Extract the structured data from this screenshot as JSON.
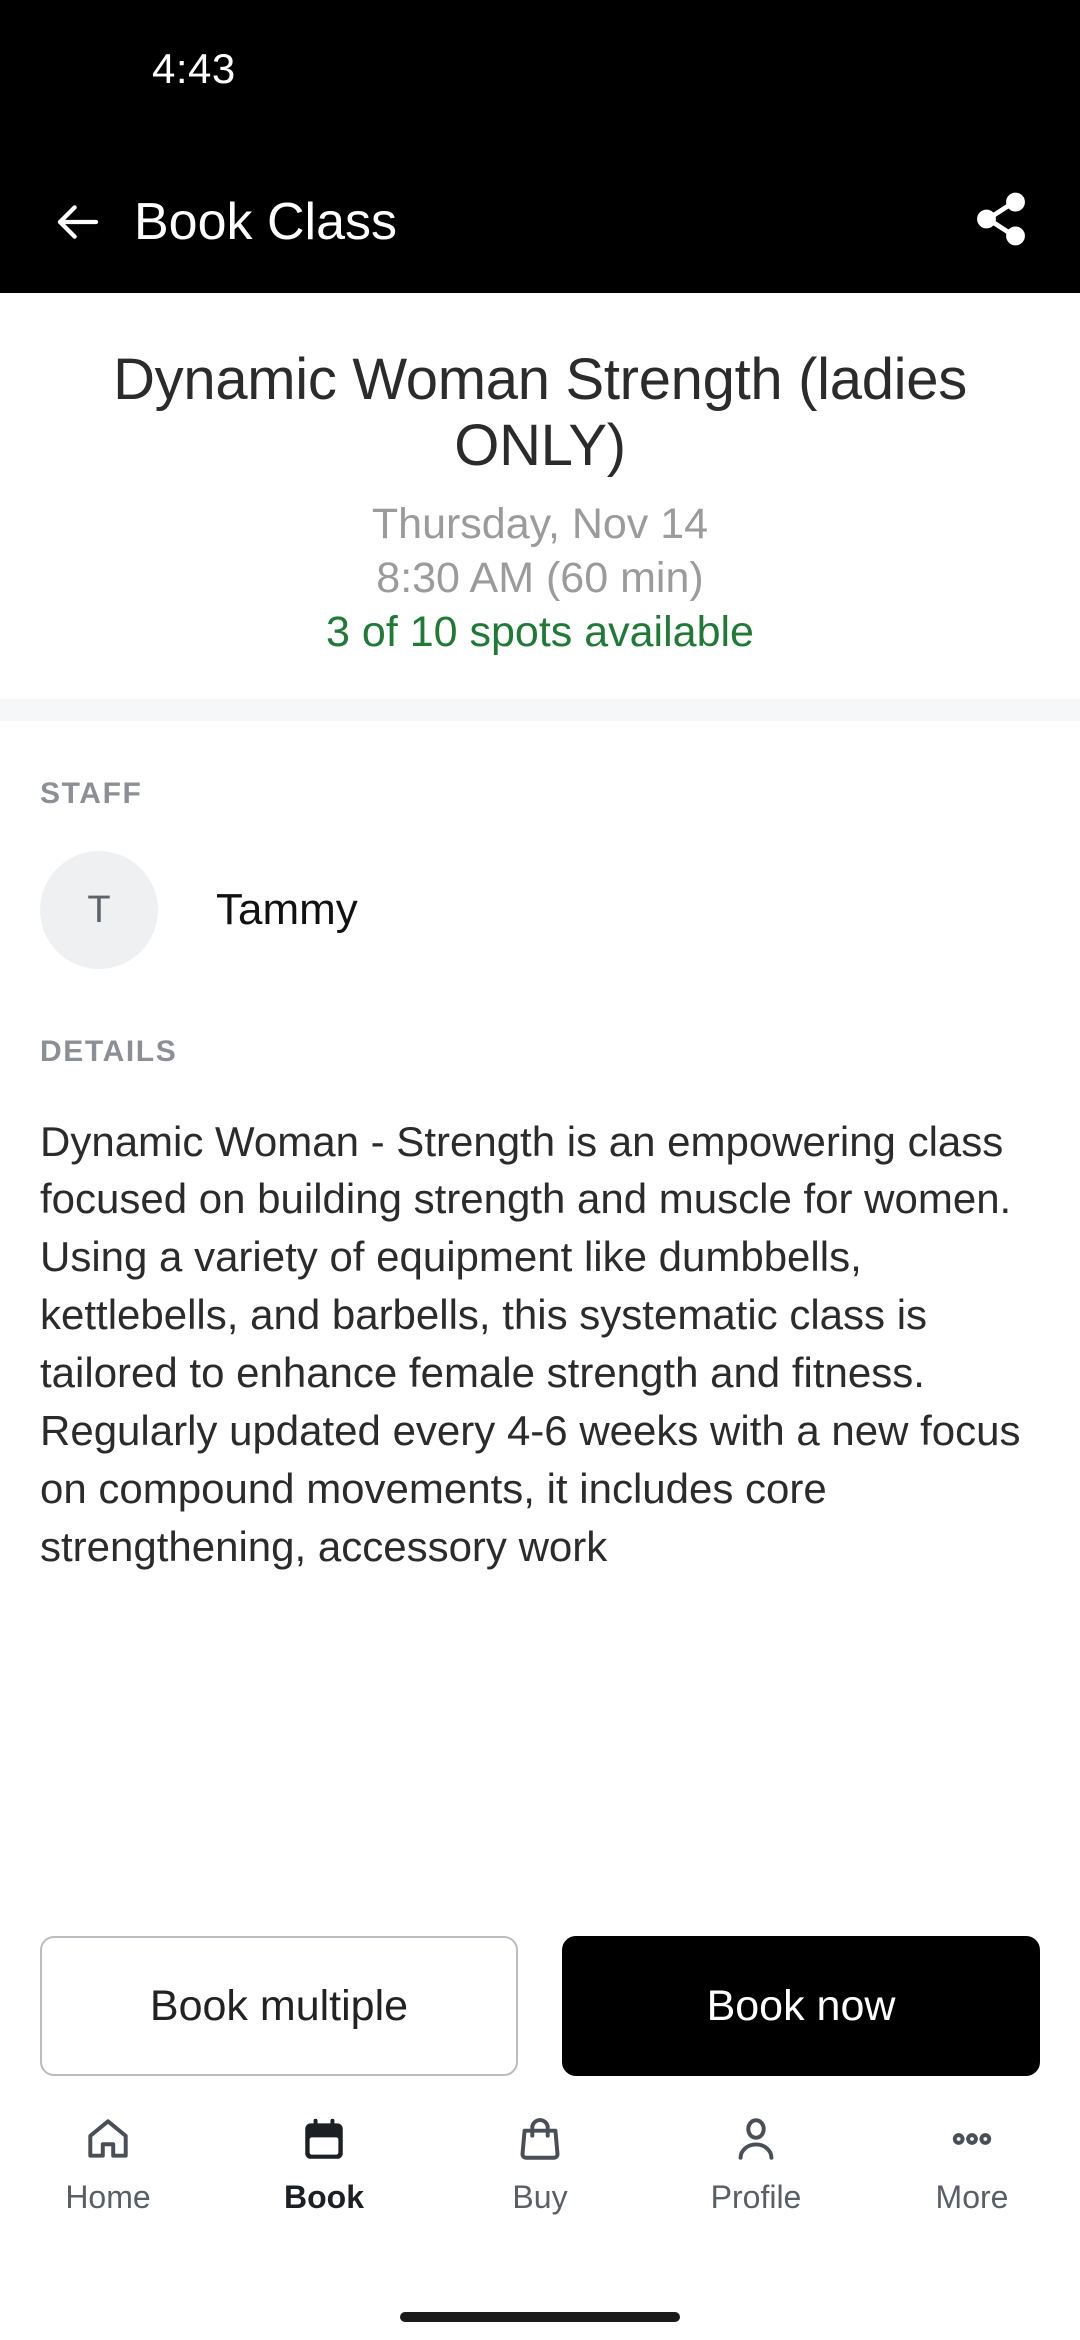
{
  "status_bar": {
    "time": "4:43"
  },
  "app_bar": {
    "title": "Book Class",
    "back_icon": "arrow-left-icon",
    "share_icon": "share-icon"
  },
  "hero": {
    "class_title": "Dynamic Woman Strength (ladies ONLY)",
    "date": "Thursday, Nov 14",
    "time": "8:30 AM (60 min)",
    "spots": "3 of 10 spots available",
    "spots_color": "#1f7a36",
    "muted_color": "#9b9b9b"
  },
  "staff": {
    "label": "STAFF",
    "avatar_initial": "T",
    "name": "Tammy"
  },
  "details": {
    "label": "DETAILS",
    "text": "Dynamic Woman - Strength is an empowering class focused on building strength and muscle for women. Using a variety of equipment like dumbbells, kettlebells, and barbells, this systematic class is tailored to enhance female strength and fitness. Regularly updated every 4-6 weeks with a new focus on compound movements, it includes core strengthening, accessory work"
  },
  "actions": {
    "secondary_label": "Book multiple",
    "primary_label": "Book now",
    "primary_bg": "#000000",
    "secondary_border": "#b9bcc0"
  },
  "bottom_nav": {
    "items": [
      {
        "label": "Home",
        "icon": "home-icon",
        "active": false
      },
      {
        "label": "Book",
        "icon": "calendar-icon",
        "active": true
      },
      {
        "label": "Buy",
        "icon": "bag-icon",
        "active": false
      },
      {
        "label": "Profile",
        "icon": "person-icon",
        "active": false
      },
      {
        "label": "More",
        "icon": "more-dots-icon",
        "active": false
      }
    ]
  }
}
